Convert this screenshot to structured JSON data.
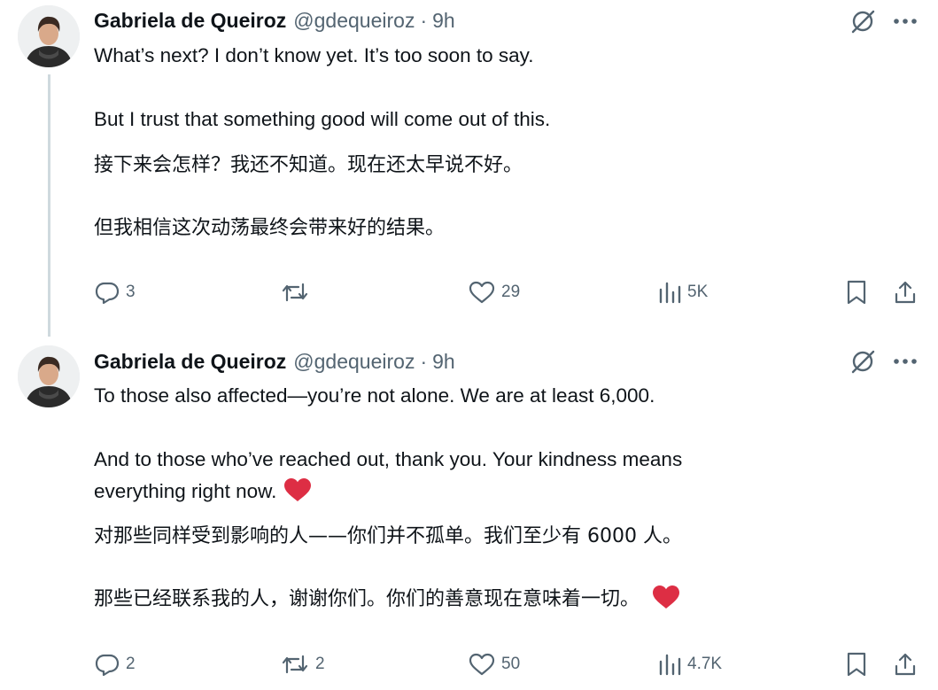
{
  "tweets": [
    {
      "author": {
        "name": "Gabriela de Queiroz",
        "handle": "@gdequeiroz",
        "separator": "·",
        "time": "9h"
      },
      "paragraphs": [
        "What’s next? I don’t know yet. It’s too soon to say.",
        "But I trust that something good will come out of this.",
        "接下来会怎样？我还不知道。现在还太早说不好。",
        "但我相信这次动荡最终会带来好的结果。"
      ],
      "stats": {
        "replies": "3",
        "reposts": "",
        "likes": "29",
        "views": "5K"
      }
    },
    {
      "author": {
        "name": "Gabriela de Queiroz",
        "handle": "@gdequeiroz",
        "separator": "·",
        "time": "9h"
      },
      "paragraphs": [
        "To those also affected—you’re not alone. We are at least 6,000.",
        "And to those who’ve reached out, thank you. Your kindness means",
        "everything right now.",
        "对那些同样受到影响的人——你们并不孤单。我们至少有 6000 人。",
        "那些已经联系我的人，谢谢你们。你们的善意现在意味着一切。"
      ],
      "stats": {
        "replies": "2",
        "reposts": "2",
        "likes": "50",
        "views": "4.7K"
      }
    }
  ],
  "icons": {
    "grok": "grok-icon",
    "more": "more-icon",
    "reply": "reply-icon",
    "repost": "repost-icon",
    "like": "like-icon",
    "views": "views-icon",
    "bookmark": "bookmark-icon",
    "share": "share-icon",
    "heart_emoji": "red-heart-emoji"
  },
  "colors": {
    "text": "#0f1419",
    "secondary": "#536471",
    "heart": "#dd2e44",
    "thread_line": "#cfd9de"
  }
}
